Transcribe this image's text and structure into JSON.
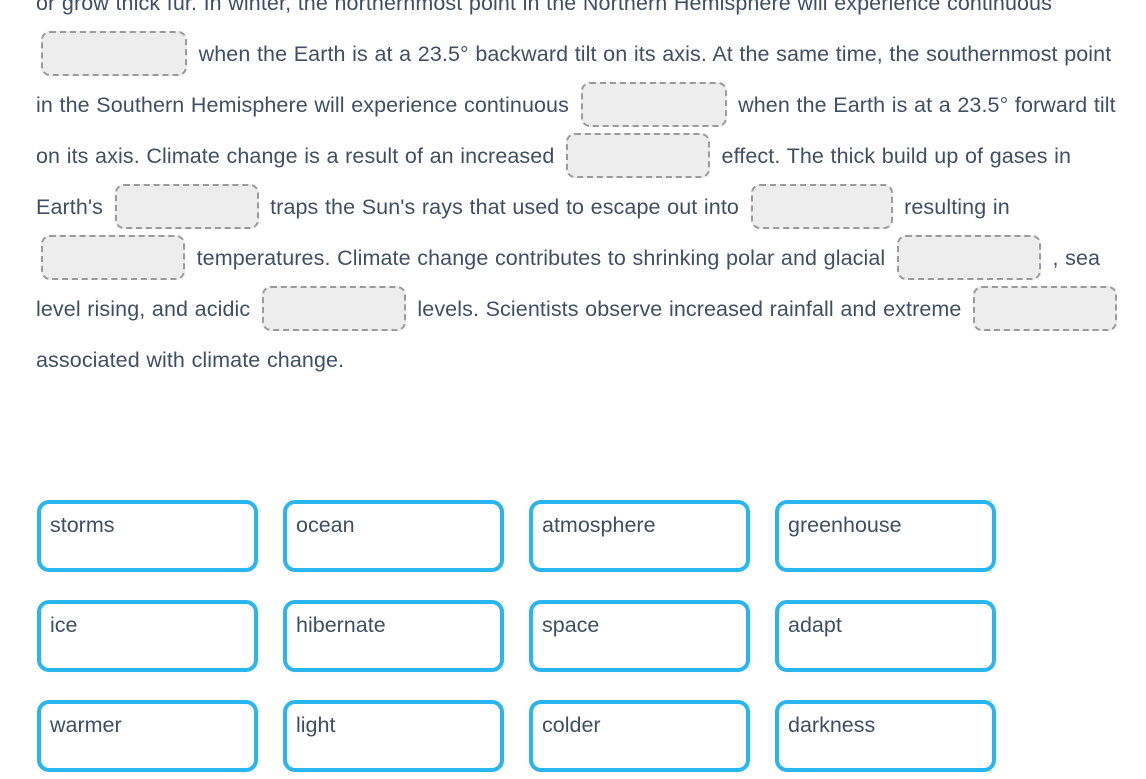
{
  "colors": {
    "text": "#3f4f63",
    "tile_border": "#29b6ef",
    "blank_fill": "#ededed",
    "blank_border": "#9a9a9a",
    "background": "#ffffff"
  },
  "passage": {
    "segments": [
      {
        "type": "text",
        "value": "or grow thick fur. In winter, the northernmost point in the Northern Hemisphere will experience continuous "
      },
      {
        "type": "blank",
        "size": "w-wide",
        "name": "blank-1"
      },
      {
        "type": "text",
        "value": " when the Earth is at a 23.5° backward tilt on its axis. At the same time, the southernmost point in the Southern Hemisphere will experience continuous "
      },
      {
        "type": "blank",
        "size": "w-wide",
        "name": "blank-2"
      },
      {
        "type": "text",
        "value": " when the Earth is at a 23.5° forward tilt on its axis. Climate change is a result of an increased "
      },
      {
        "type": "blank",
        "size": "w-mid",
        "name": "blank-3"
      },
      {
        "type": "text",
        "value": " effect. The thick build up of gases in Earth's "
      },
      {
        "type": "blank",
        "size": "w-mid",
        "name": "blank-4"
      },
      {
        "type": "text",
        "value": " traps the Sun's rays that used to escape out into "
      },
      {
        "type": "blank",
        "size": "w-narrow",
        "name": "blank-5"
      },
      {
        "type": "text",
        "value": " resulting in "
      },
      {
        "type": "blank",
        "size": "w-mid",
        "name": "blank-6"
      },
      {
        "type": "text",
        "value": " temperatures. Climate change contributes to shrinking polar and glacial "
      },
      {
        "type": "blank",
        "size": "w-mid",
        "name": "blank-7"
      },
      {
        "type": "text",
        "value": " , sea level rising, and acidic "
      },
      {
        "type": "blank",
        "size": "w-mid",
        "name": "blank-8"
      },
      {
        "type": "text",
        "value": " levels. Scientists observe increased rainfall and extreme "
      },
      {
        "type": "blank",
        "size": "w-mid",
        "name": "blank-9"
      },
      {
        "type": "text",
        "value": " associated with climate change."
      }
    ]
  },
  "word_bank": {
    "tiles": [
      {
        "label": "storms",
        "name": "word-tile-storms"
      },
      {
        "label": "ocean",
        "name": "word-tile-ocean"
      },
      {
        "label": "atmosphere",
        "name": "word-tile-atmosphere"
      },
      {
        "label": "greenhouse",
        "name": "word-tile-greenhouse"
      },
      {
        "label": "ice",
        "name": "word-tile-ice"
      },
      {
        "label": "hibernate",
        "name": "word-tile-hibernate"
      },
      {
        "label": "space",
        "name": "word-tile-space"
      },
      {
        "label": "adapt",
        "name": "word-tile-adapt"
      },
      {
        "label": "warmer",
        "name": "word-tile-warmer"
      },
      {
        "label": "light",
        "name": "word-tile-light"
      },
      {
        "label": "colder",
        "name": "word-tile-colder"
      },
      {
        "label": "darkness",
        "name": "word-tile-darkness"
      }
    ]
  }
}
